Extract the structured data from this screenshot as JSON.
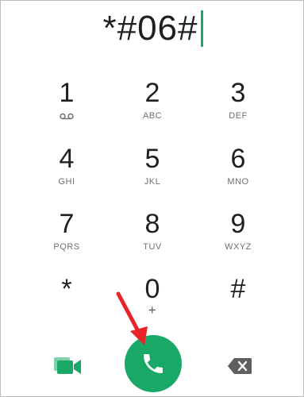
{
  "display": {
    "dialed_number": "*#06#"
  },
  "keypad": {
    "keys": [
      {
        "digit": "1",
        "sub": "",
        "sub_icon": "voicemail-icon"
      },
      {
        "digit": "2",
        "sub": "ABC"
      },
      {
        "digit": "3",
        "sub": "DEF"
      },
      {
        "digit": "4",
        "sub": "GHI"
      },
      {
        "digit": "5",
        "sub": "JKL"
      },
      {
        "digit": "6",
        "sub": "MNO"
      },
      {
        "digit": "7",
        "sub": "PQRS"
      },
      {
        "digit": "8",
        "sub": "TUV"
      },
      {
        "digit": "9",
        "sub": "WXYZ"
      },
      {
        "digit": "*",
        "sub": ""
      },
      {
        "digit": "0",
        "sub": "+"
      },
      {
        "digit": "#",
        "sub": ""
      }
    ]
  },
  "actions": {
    "video_icon": "video-call-icon",
    "call_icon": "phone-icon",
    "backspace_icon": "backspace-icon"
  },
  "colors": {
    "accent_green": "#1aa867",
    "annotation_red": "#e8232a",
    "digit_text": "#202020",
    "sub_text": "#6f6f6f"
  }
}
